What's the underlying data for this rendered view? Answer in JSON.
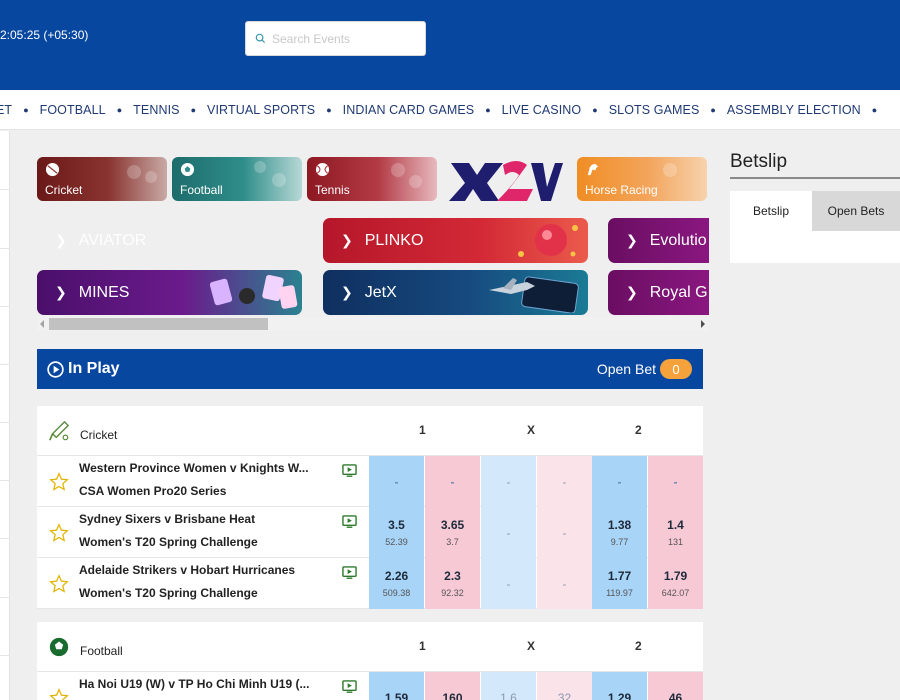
{
  "header": {
    "clock": "2:05:25 (+05:30)",
    "search_placeholder": "Search Events"
  },
  "nav": [
    "ET",
    "FOOTBALL",
    "TENNIS",
    "VIRTUAL SPORTS",
    "INDIAN CARD GAMES",
    "LIVE CASINO",
    "SLOTS GAMES",
    "ASSEMBLY ELECTION"
  ],
  "sport_tiles": {
    "cricket": "Cricket",
    "football": "Football",
    "tennis": "Tennis",
    "horse_racing": "Horse Racing"
  },
  "casino": {
    "aviator": "AVIATOR",
    "plinko": "PLINKO",
    "evolution": "Evolutio",
    "mines": "MINES",
    "jetx": "JetX",
    "royal": "Royal G"
  },
  "inplay": {
    "title": "In Play",
    "open_bet_label": "Open Bet",
    "open_bet_count": "0"
  },
  "cricket": {
    "sport": "Cricket",
    "cols": [
      "1",
      "X",
      "2"
    ],
    "rows": [
      {
        "event": "Western Province Women v Knights W...",
        "competition": "CSA Women Pro20 Series",
        "odds": [
          [
            "-",
            ""
          ],
          [
            "-",
            ""
          ],
          [
            "-",
            ""
          ],
          [
            "-",
            ""
          ],
          [
            "-",
            ""
          ],
          [
            "-",
            ""
          ]
        ]
      },
      {
        "event": "Sydney Sixers v Brisbane Heat",
        "competition": "Women's T20 Spring Challenge",
        "odds": [
          [
            "3.5",
            "52.39"
          ],
          [
            "3.65",
            "3.7"
          ],
          [
            "-",
            ""
          ],
          [
            "-",
            ""
          ],
          [
            "1.38",
            "9.77"
          ],
          [
            "1.4",
            "131"
          ]
        ]
      },
      {
        "event": "Adelaide Strikers v Hobart Hurricanes",
        "competition": "Women's T20 Spring Challenge",
        "odds": [
          [
            "2.26",
            "509.38"
          ],
          [
            "2.3",
            "92.32"
          ],
          [
            "-",
            ""
          ],
          [
            "-",
            ""
          ],
          [
            "1.77",
            "119.97"
          ],
          [
            "1.79",
            "642.07"
          ]
        ]
      }
    ]
  },
  "football": {
    "sport": "Football",
    "cols": [
      "1",
      "X",
      "2"
    ],
    "rows": [
      {
        "event": "Ha Noi U19 (W) v TP Ho Chi Minh U19 (...",
        "competition": "",
        "odds": [
          [
            "1.59",
            ""
          ],
          [
            "160",
            ""
          ],
          [
            "1.6",
            ""
          ],
          [
            "32",
            ""
          ],
          [
            "1.29",
            ""
          ],
          [
            "46",
            ""
          ]
        ]
      }
    ]
  },
  "betslip": {
    "title": "Betslip",
    "tab_betslip": "Betslip",
    "tab_open_bets": "Open Bets"
  }
}
